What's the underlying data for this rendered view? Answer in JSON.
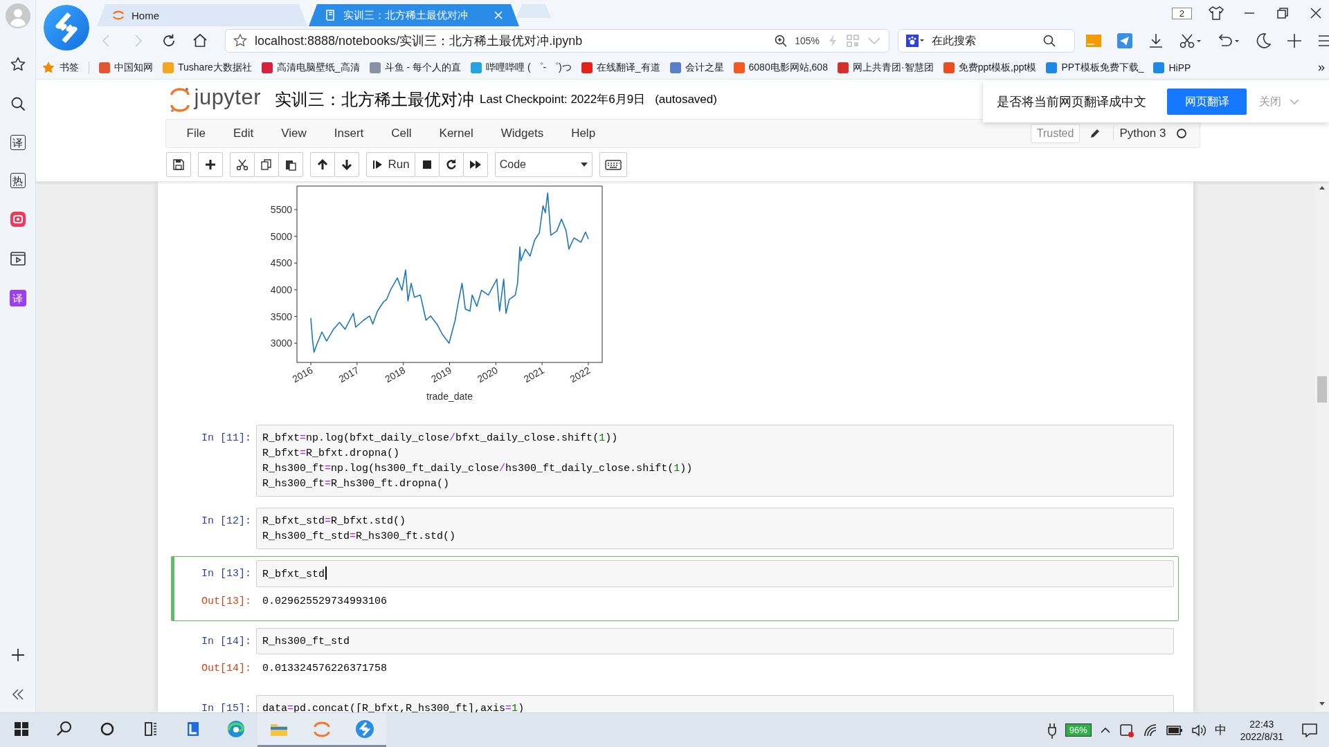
{
  "sidebar": {
    "items": [
      {
        "kind": "favorites"
      },
      {
        "kind": "search"
      },
      {
        "kind": "glyph",
        "text": "译"
      },
      {
        "kind": "glyph",
        "text": "热"
      },
      {
        "kind": "app"
      },
      {
        "kind": "video"
      },
      {
        "kind": "badge",
        "text": "译"
      }
    ],
    "bottom": [
      {
        "kind": "add"
      },
      {
        "kind": "collapse"
      }
    ]
  },
  "browser": {
    "tabs": [
      {
        "title": "Home",
        "selected": false
      },
      {
        "title": "实训三：北方稀土最优对冲",
        "selected": true
      }
    ],
    "tab_count": "2",
    "nav": [
      {
        "kind": "back",
        "disabled": true
      },
      {
        "kind": "forward",
        "disabled": true
      },
      {
        "kind": "reload",
        "disabled": false
      },
      {
        "kind": "home",
        "disabled": false
      }
    ],
    "address": {
      "value": "localhost:8888/notebooks/实训三：北方稀土最优对冲.ipynb",
      "zoom": "105%"
    },
    "search": {
      "placeholder": "在此搜索"
    },
    "bookmarks": {
      "label": "书签",
      "items": [
        "中国知网",
        "Tushare大数据社",
        "高清电脑壁纸_高清",
        "斗鱼 - 每个人的直",
        "哔哩哔哩 ( ゜- ゜)つ",
        "在线翻译_有道",
        "会计之星",
        "6080电影网站,608",
        "网上共青团·智慧团",
        "免费ppt模板,ppt模",
        "PPT模板免费下载_",
        "HiPP"
      ],
      "more": "»"
    }
  },
  "jupyter": {
    "logo_text": "jupyter",
    "title": "实训三：北方稀土最优对冲",
    "checkpoint": "Last Checkpoint: 2022年6月9日",
    "autosave": "(autosaved)",
    "menu": [
      "File",
      "Edit",
      "View",
      "Insert",
      "Cell",
      "Kernel",
      "Widgets",
      "Help"
    ],
    "trusted": "Trusted",
    "kernel": {
      "name": "Python 3",
      "busy": false
    },
    "toolbar": {
      "run": "Run",
      "cell_type": "Code"
    }
  },
  "translate": {
    "prompt": "是否将当前网页翻译成中文",
    "button": "网页翻译",
    "close": "关闭"
  },
  "cells": [
    {
      "kind": "plot",
      "chart_data": {
        "type": "line",
        "xlabel": "trade_date",
        "xlim": [
          2015.7,
          2022.3
        ],
        "ylim": [
          2640,
          5940
        ],
        "x": [
          2016.0,
          2016.04,
          2016.07,
          2016.14,
          2016.24,
          2016.34,
          2016.49,
          2016.62,
          2016.74,
          2016.92,
          2016.97,
          2017.14,
          2017.27,
          2017.34,
          2017.44,
          2017.57,
          2017.64,
          2017.72,
          2017.87,
          2017.97,
          2018.05,
          2018.1,
          2018.17,
          2018.24,
          2018.37,
          2018.49,
          2018.59,
          2018.74,
          2018.84,
          2018.99,
          2019.12,
          2019.19,
          2019.27,
          2019.34,
          2019.44,
          2019.49,
          2019.59,
          2019.69,
          2019.84,
          2020.02,
          2020.08,
          2020.17,
          2020.22,
          2020.29,
          2020.42,
          2020.47,
          2020.52,
          2020.54,
          2020.64,
          2020.74,
          2020.84,
          2020.94,
          2021.02,
          2021.07,
          2021.12,
          2021.19,
          2021.32,
          2021.42,
          2021.52,
          2021.58,
          2021.69,
          2021.84,
          2021.94,
          2022.0
        ],
        "series": [
          {
            "color": "#1f77b4",
            "values": [
              3470,
              3040,
              2830,
              3000,
              3210,
              3040,
              3260,
              3390,
              3260,
              3560,
              3300,
              3430,
              3510,
              3360,
              3600,
              3770,
              3820,
              3990,
              4220,
              3990,
              4370,
              3790,
              4120,
              3860,
              3900,
              3430,
              3510,
              3340,
              3170,
              3000,
              3430,
              3770,
              4120,
              3640,
              3600,
              3900,
              3690,
              3990,
              3900,
              4200,
              3600,
              4200,
              3560,
              3820,
              3900,
              4120,
              4800,
              4540,
              4760,
              4630,
              4930,
              5060,
              5570,
              5440,
              5810,
              5020,
              5100,
              5320,
              5100,
              4760,
              4970,
              4890,
              5080,
              4950
            ]
          }
        ],
        "xticks": [
          {
            "value": 2016,
            "label": "2016"
          },
          {
            "value": 2017,
            "label": "2017"
          },
          {
            "value": 2018,
            "label": "2018"
          },
          {
            "value": 2019,
            "label": "2019"
          },
          {
            "value": 2020,
            "label": "2020"
          },
          {
            "value": 2021,
            "label": "2021"
          },
          {
            "value": 2022,
            "label": "2022"
          }
        ],
        "yticks": [
          3000,
          3500,
          4000,
          4500,
          5000,
          5500
        ]
      }
    },
    {
      "kind": "code",
      "prompt": "In [11]:",
      "selected": false,
      "lines": [
        "R_bfxt=np.log(bfxt_daily_close/bfxt_daily_close.shift(1))",
        "R_bfxt=R_bfxt.dropna()",
        "R_hs300_ft=np.log(hs300_ft_daily_close/hs300_ft_daily_close.shift(1))",
        "R_hs300_ft=R_hs300_ft.dropna()"
      ]
    },
    {
      "kind": "code",
      "prompt": "In [12]:",
      "selected": false,
      "lines": [
        "R_bfxt_std=R_bfxt.std()",
        "R_hs300_ft_std=R_hs300_ft.std()"
      ]
    },
    {
      "kind": "code",
      "prompt": "In [13]:",
      "selected": true,
      "lines": [
        "R_bfxt_std"
      ],
      "output": {
        "prompt": "Out[13]:",
        "text": "0.029625529734993106"
      }
    },
    {
      "kind": "code",
      "prompt": "In [14]:",
      "selected": false,
      "lines": [
        "R_hs300_ft_std"
      ],
      "output": {
        "prompt": "Out[14]:",
        "text": "0.013324576226371758"
      }
    },
    {
      "kind": "code",
      "prompt": "In [15]:",
      "selected": false,
      "lines": [
        "data=pd.concat([R_bfxt,R_hs300_ft],axis=1)"
      ]
    }
  ],
  "taskbar": {
    "apps": [
      {
        "kind": "start",
        "active": false
      },
      {
        "kind": "search",
        "active": false
      },
      {
        "kind": "cortana",
        "active": false
      },
      {
        "kind": "taskview",
        "active": false
      },
      {
        "kind": "letter",
        "active": false
      },
      {
        "kind": "swirl",
        "active": false
      },
      {
        "kind": "folder",
        "active": true
      },
      {
        "kind": "arcs",
        "active": true
      },
      {
        "kind": "logo",
        "active": true
      }
    ],
    "battery": "96%",
    "ime": "中",
    "time": "22:43",
    "date": "2022/8/31"
  }
}
